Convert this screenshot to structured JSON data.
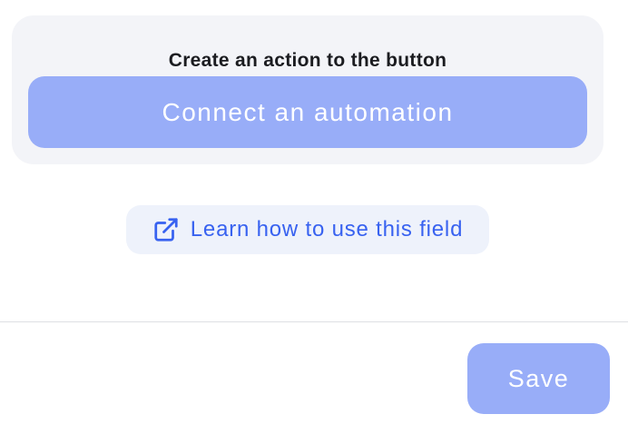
{
  "action_card": {
    "title": "Create an action to the button",
    "connect_button_label": "Connect an automation"
  },
  "learn_link": {
    "icon": "external-link-icon",
    "label": "Learn how to use this field"
  },
  "footer": {
    "save_label": "Save"
  },
  "colors": {
    "primary_disabled": "#98adf8",
    "link": "#3862f0",
    "card_background": "#f3f4f8",
    "link_background": "#eef2fb"
  }
}
